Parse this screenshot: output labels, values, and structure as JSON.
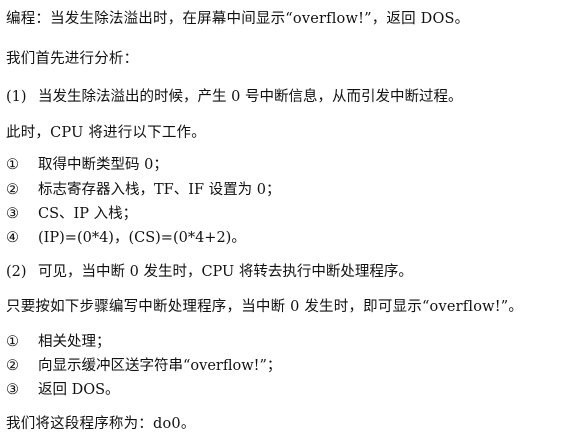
{
  "doc": {
    "intro": "编程：当发生除法溢出时，在屏幕中间显示“overflow!”，返回 DOS。",
    "analysis_intro": "我们首先进行分析：",
    "point1": {
      "num": "(1)",
      "text": "当发生除法溢出的时候，产生 0 号中断信息，从而引发中断过程。"
    },
    "cpu_work": "此时，CPU 将进行以下工作。",
    "steps": [
      {
        "num": "①",
        "text": "取得中断类型码 0；"
      },
      {
        "num": "②",
        "text": "标志寄存器入栈，TF、IF 设置为 0；"
      },
      {
        "num": "③",
        "text": "CS、IP 入栈；"
      },
      {
        "num": "④",
        "text": "(IP)=(0*4)，(CS)=(0*4+2)。"
      }
    ],
    "point2": {
      "num": "(2)",
      "text": "可见，当中断 0 发生时，CPU 将转去执行中断处理程序。"
    },
    "handler_intro": "只要按如下步骤编写中断处理程序，当中断 0 发生时，即可显示“overflow!”。",
    "handler_steps": [
      {
        "num": "①",
        "text": "相关处理；"
      },
      {
        "num": "②",
        "text": "向显示缓冲区送字符串“overflow!”；"
      },
      {
        "num": "③",
        "text": "返回 DOS。"
      }
    ],
    "conclusion": "我们将这段程序称为：do0。"
  }
}
